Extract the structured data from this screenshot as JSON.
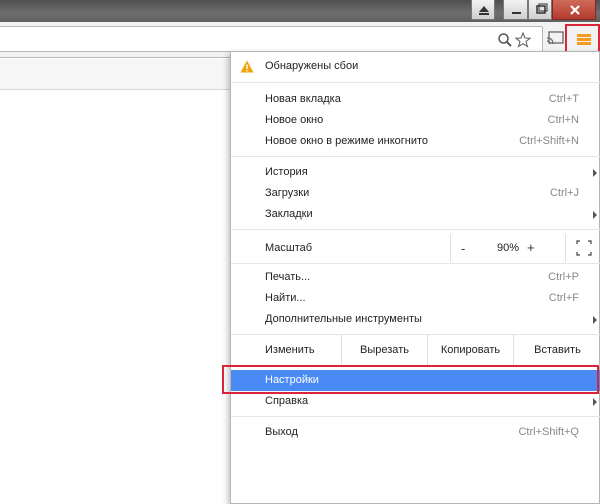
{
  "menu": {
    "crash_notice": "Обнаружены сбои",
    "group1": [
      {
        "label": "Новая вкладка",
        "shortcut": "Ctrl+T"
      },
      {
        "label": "Новое окно",
        "shortcut": "Ctrl+N"
      },
      {
        "label": "Новое окно в режиме инкогнито",
        "shortcut": "Ctrl+Shift+N"
      }
    ],
    "group2": [
      {
        "label": "История"
      },
      {
        "label": "Загрузки",
        "shortcut": "Ctrl+J"
      },
      {
        "label": "Закладки"
      }
    ],
    "zoom": {
      "label": "Масштаб",
      "minus": "-",
      "value": "90%",
      "plus": "+"
    },
    "group3": [
      {
        "label": "Печать...",
        "shortcut": "Ctrl+P"
      },
      {
        "label": "Найти...",
        "shortcut": "Ctrl+F"
      },
      {
        "label": "Дополнительные инструменты"
      }
    ],
    "edit": {
      "label": "Изменить",
      "cut": "Вырезать",
      "copy": "Копировать",
      "paste": "Вставить"
    },
    "settings": "Настройки",
    "help": "Справка",
    "exit": {
      "label": "Выход",
      "shortcut": "Ctrl+Shift+Q"
    }
  },
  "colors": {
    "accent": "#4a8af4",
    "menu_icon": "#f39c1f",
    "highlight": "#d9253a",
    "warning": "#f0a30a"
  },
  "icons": {
    "zoom": "magnifier-icon",
    "bookmark": "star-icon",
    "cast": "cast-icon",
    "menu": "hamburger-menu-icon",
    "warning": "warning-icon",
    "fullscreen": "fullscreen-icon"
  }
}
